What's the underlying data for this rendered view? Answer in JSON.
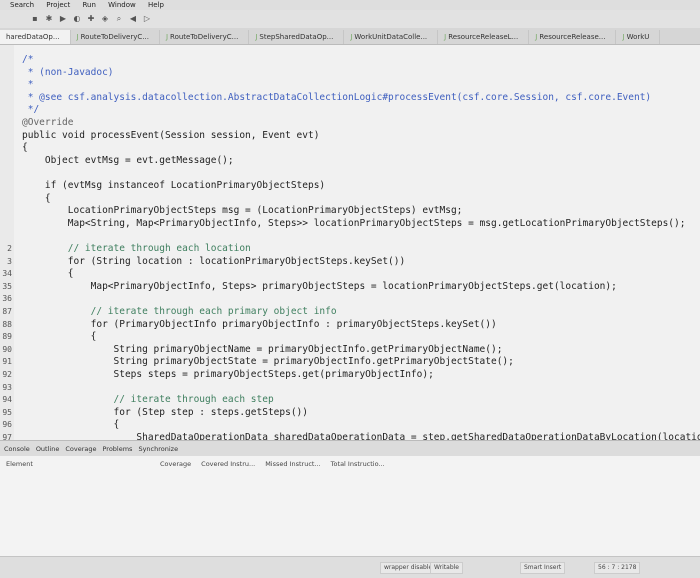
{
  "menu": [
    "Search",
    "Project",
    "Run",
    "Window",
    "Help"
  ],
  "editor_tabs": [
    {
      "label": "haredDataOp...",
      "active": true
    },
    {
      "label": "RouteToDeliveryC...",
      "active": false
    },
    {
      "label": "RouteToDeliveryC...",
      "active": false
    },
    {
      "label": "StepSharedDataOp...",
      "active": false
    },
    {
      "label": "WorkUnitDataColle...",
      "active": false
    },
    {
      "label": "ResourceReleaseL...",
      "active": false
    },
    {
      "label": "ResourceRelease...",
      "active": false
    },
    {
      "label": "WorkU",
      "active": false
    }
  ],
  "code_lines": [
    {
      "ln": "",
      "text": "/*"
    },
    {
      "ln": "",
      "text": " * (non-Javadoc)"
    },
    {
      "ln": "",
      "text": " *"
    },
    {
      "ln": "",
      "text": " * @see csf.analysis.datacollection.AbstractDataCollectionLogic#processEvent(csf.core.Session, csf.core.Event)"
    },
    {
      "ln": "",
      "text": " */"
    },
    {
      "ln": "",
      "text": "@Override"
    },
    {
      "ln": "",
      "text": "public void processEvent(Session session, Event evt)"
    },
    {
      "ln": "",
      "text": "{"
    },
    {
      "ln": "",
      "text": "    Object evtMsg = evt.getMessage();"
    },
    {
      "ln": "",
      "text": ""
    },
    {
      "ln": "",
      "text": "    if (evtMsg instanceof LocationPrimaryObjectSteps)"
    },
    {
      "ln": "",
      "text": "    {"
    },
    {
      "ln": "",
      "text": "        LocationPrimaryObjectSteps msg = (LocationPrimaryObjectSteps) evtMsg;"
    },
    {
      "ln": "",
      "text": "        Map<String, Map<PrimaryObjectInfo, Steps>> locationPrimaryObjectSteps = msg.getLocationPrimaryObjectSteps();"
    },
    {
      "ln": "",
      "text": ""
    },
    {
      "ln": "2",
      "text": "        // iterate through each location"
    },
    {
      "ln": "3",
      "text": "        for (String location : locationPrimaryObjectSteps.keySet())"
    },
    {
      "ln": "34",
      "text": "        {"
    },
    {
      "ln": "35",
      "text": "            Map<PrimaryObjectInfo, Steps> primaryObjectSteps = locationPrimaryObjectSteps.get(location);"
    },
    {
      "ln": "36",
      "text": ""
    },
    {
      "ln": "87",
      "text": "            // iterate through each primary object info"
    },
    {
      "ln": "88",
      "text": "            for (PrimaryObjectInfo primaryObjectInfo : primaryObjectSteps.keySet())"
    },
    {
      "ln": "89",
      "text": "            {"
    },
    {
      "ln": "90",
      "text": "                String primaryObjectName = primaryObjectInfo.getPrimaryObjectName();"
    },
    {
      "ln": "91",
      "text": "                String primaryObjectState = primaryObjectInfo.getPrimaryObjectState();"
    },
    {
      "ln": "92",
      "text": "                Steps steps = primaryObjectSteps.get(primaryObjectInfo);"
    },
    {
      "ln": "93",
      "text": ""
    },
    {
      "ln": "94",
      "text": "                // iterate through each step"
    },
    {
      "ln": "95",
      "text": "                for (Step step : steps.getSteps())"
    },
    {
      "ln": "96",
      "text": "                {"
    },
    {
      "ln": "97",
      "text": "                    SharedDataOperationData sharedDataOperationData = step.getSharedDataOperationDataByLocation(location);"
    }
  ],
  "bottom_tabs": [
    "Console",
    "Outline",
    "Coverage",
    "Problems",
    "Synchronize"
  ],
  "coverage_panel": {
    "element_label": "Element",
    "columns": [
      "Coverage",
      "Covered Instru...",
      "Missed Instruct...",
      "Total Instructio..."
    ]
  },
  "status": {
    "write_mode": "Writable",
    "insert_mode": "Smart Insert",
    "position": "56 : 7 : 2178",
    "wrapper": "wrapper disabled"
  }
}
